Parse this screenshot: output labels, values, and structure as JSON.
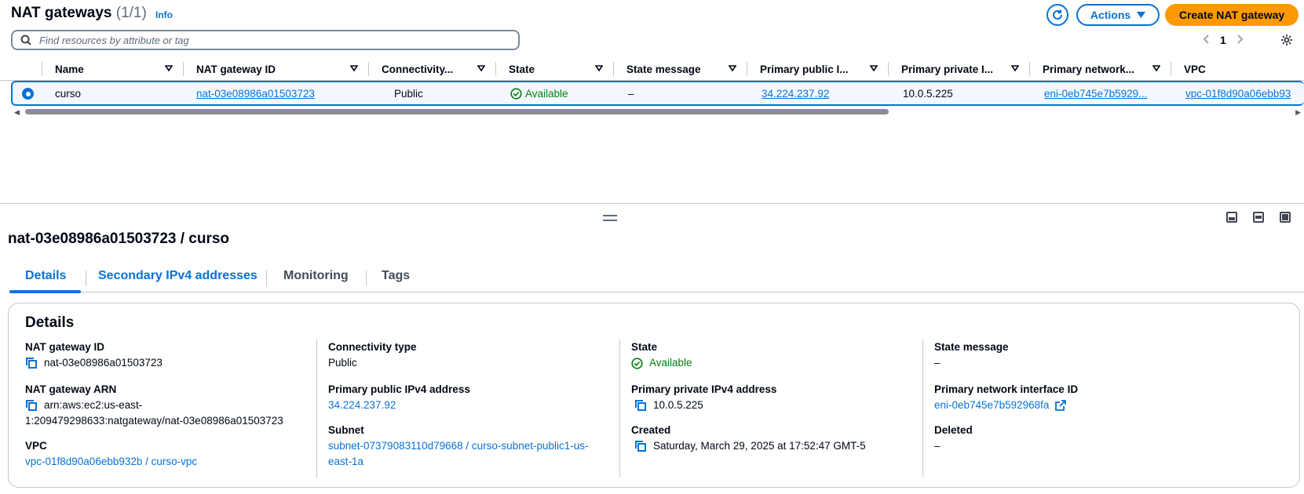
{
  "header": {
    "title": "NAT gateways",
    "count": "(1/1)",
    "info": "Info",
    "actions_label": "Actions",
    "create_label": "Create NAT gateway"
  },
  "search": {
    "placeholder": "Find resources by attribute or tag",
    "value": ""
  },
  "pagination": {
    "current_page": "1"
  },
  "table": {
    "columns": [
      "Name",
      "NAT gateway ID",
      "Connectivity...",
      "State",
      "State message",
      "Primary public I...",
      "Primary private I...",
      "Primary network...",
      "VPC"
    ],
    "rows": [
      {
        "name": "curso",
        "nat_id": "nat-03e08986a01503723",
        "connectivity": "Public",
        "state": "Available",
        "state_message": "–",
        "public_ip": "34.224.237.92",
        "private_ip": "10.0.5.225",
        "network_interface": "eni-0eb745e7b5929...",
        "vpc": "vpc-01f8d90a06ebb93"
      }
    ]
  },
  "detail": {
    "title": "nat-03e08986a01503723 / curso",
    "tabs": [
      "Details",
      "Secondary IPv4 addresses",
      "Monitoring",
      "Tags"
    ],
    "card_title": "Details",
    "fields": {
      "nat_id_label": "NAT gateway ID",
      "nat_id_value": "nat-03e08986a01503723",
      "arn_label": "NAT gateway ARN",
      "arn_value_line1": "arn:aws:ec2:us-east-",
      "arn_value_line2": "1:209479298633:natgateway/nat-03e08986a01503723",
      "vpc_label": "VPC",
      "vpc_value": "vpc-01f8d90a06ebb932b / curso-vpc",
      "connectivity_label": "Connectivity type",
      "connectivity_value": "Public",
      "public_ip_label": "Primary public IPv4 address",
      "public_ip_value": "34.224.237.92",
      "subnet_label": "Subnet",
      "subnet_value_line1": "subnet-07379083110d79668 / curso-subnet-public1-us-",
      "subnet_value_line2": "east-1a",
      "state_label": "State",
      "state_value": "Available",
      "private_ip_label": "Primary private IPv4 address",
      "private_ip_value": "10.0.5.225",
      "created_label": "Created",
      "created_value": "Saturday, March 29, 2025 at 17:52:47 GMT-5",
      "state_message_label": "State message",
      "state_message_value": "–",
      "eni_label": "Primary network interface ID",
      "eni_value": "eni-0eb745e7b592968fa",
      "deleted_label": "Deleted",
      "deleted_value": "–"
    }
  },
  "colors": {
    "link": "#0972d3",
    "primary_button": "#ff9900",
    "success": "#037f0c",
    "selected_row_bg": "#f2f8fd",
    "border": "#c6c6cd"
  },
  "icons": [
    "refresh-icon",
    "caret-down-icon",
    "search-icon",
    "chevron-left-icon",
    "chevron-right-icon",
    "gear-icon",
    "sort-icon",
    "check-circle-icon",
    "copy-icon",
    "external-link-icon",
    "drag-handle-icon",
    "panel-view-icon"
  ]
}
